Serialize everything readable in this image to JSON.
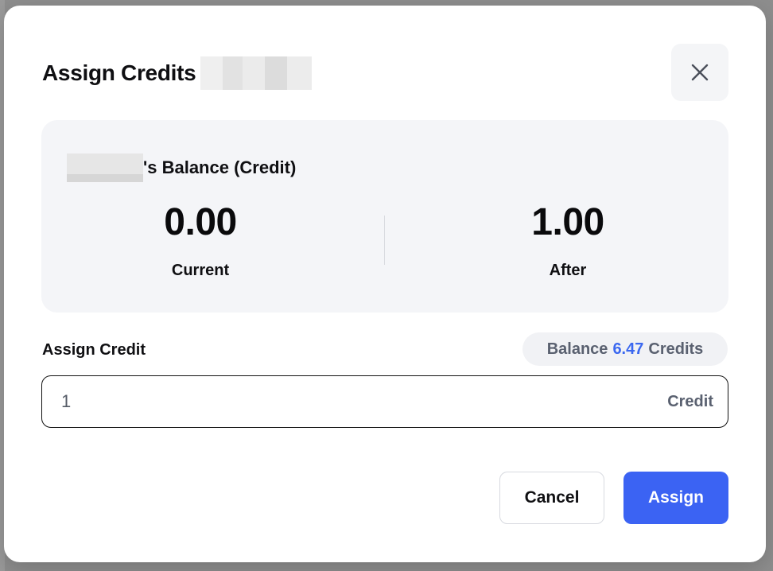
{
  "dialog": {
    "title": "Assign Credits",
    "close_icon": "close-icon"
  },
  "balance_card": {
    "heading": "'s Balance (Credit)",
    "current": {
      "value": "0.00",
      "label": "Current"
    },
    "after": {
      "value": "1.00",
      "label": "After"
    }
  },
  "assign": {
    "label": "Assign Credit",
    "balance_prefix": "Balance",
    "balance_amount": "6.47",
    "balance_suffix": "Credits",
    "input_value": "1",
    "input_suffix": "Credit"
  },
  "actions": {
    "cancel_label": "Cancel",
    "assign_label": "Assign"
  },
  "colors": {
    "accent": "#3b63f3",
    "balance_amount": "#3b68f0",
    "card_bg": "#f4f5f8"
  }
}
